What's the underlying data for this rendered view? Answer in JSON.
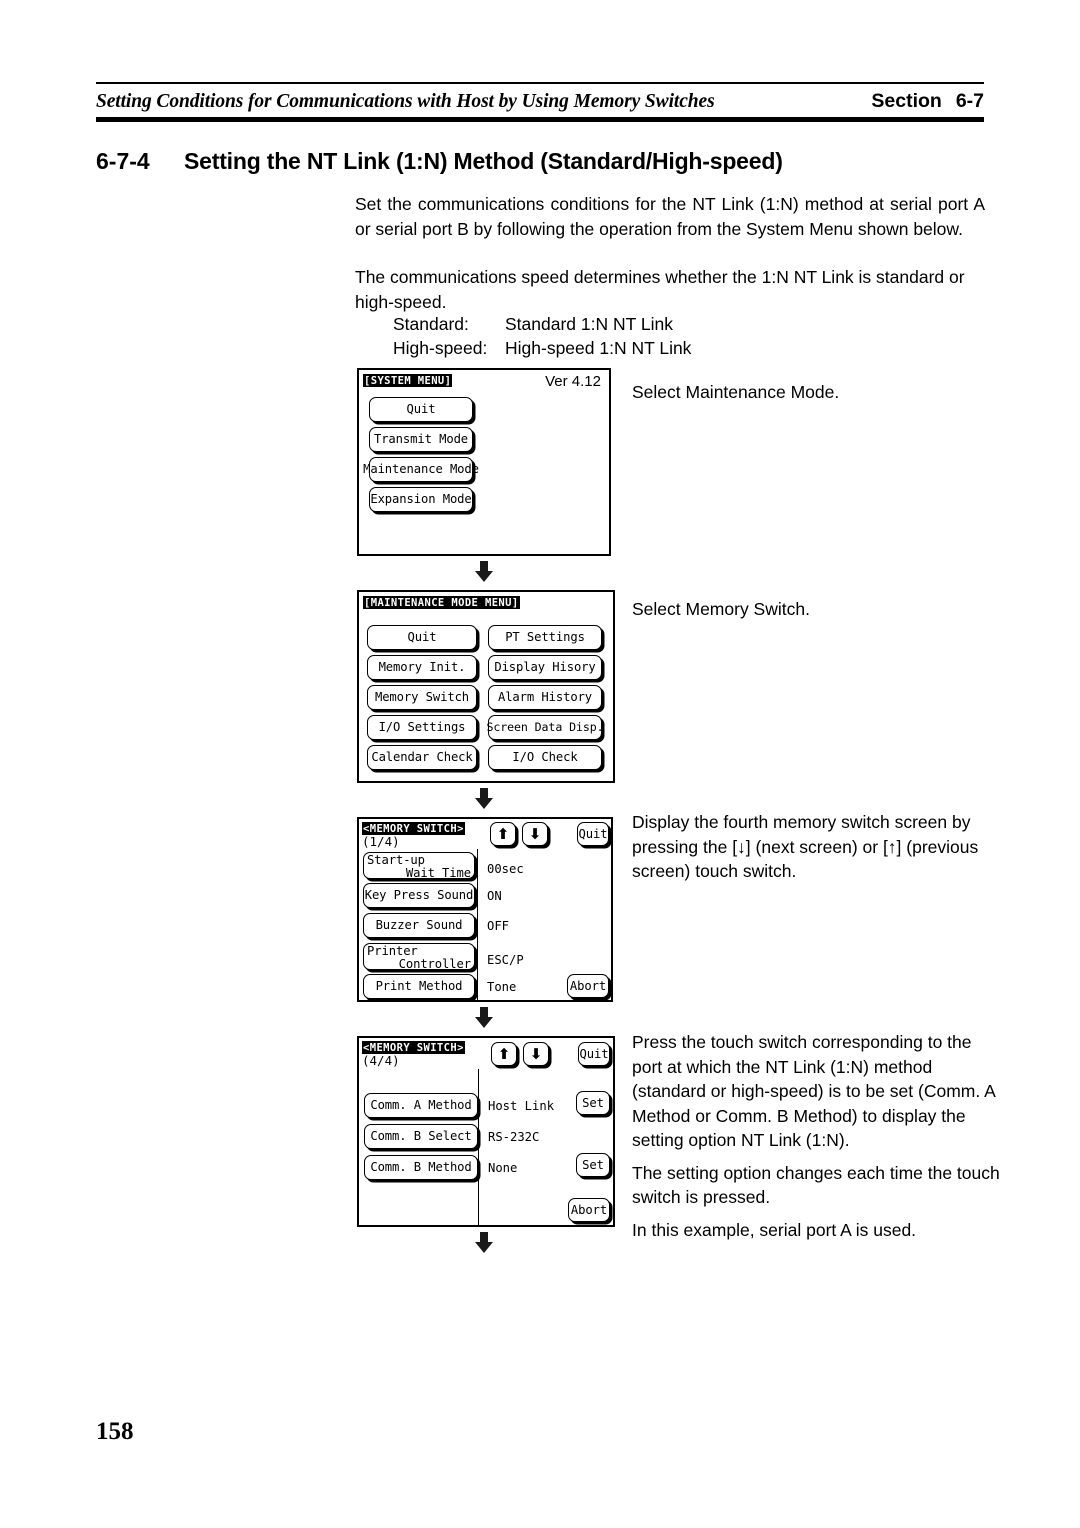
{
  "running_head": {
    "left_text": "Setting Conditions for Communications with Host by Using Memory Switches",
    "right_label": "Section",
    "right_number": "6-7"
  },
  "section": {
    "number": "6-7-4",
    "title": "Setting the NT Link (1:N) Method (Standard/High-speed)"
  },
  "intro": {
    "paragraph_1": "Set the communications conditions for the NT Link (1:N) method at serial port A or serial port B by following the operation from the System Menu shown below.",
    "paragraph_2": "The communications speed determines whether the 1:N NT Link is standard or high-speed.",
    "speed_list": [
      {
        "label": "Standard:",
        "value": "Standard 1:N NT Link"
      },
      {
        "label": "High-speed:",
        "value": "High-speed 1:N NT Link"
      }
    ]
  },
  "screens": {
    "system_menu": {
      "title": "[SYSTEM MENU]",
      "version": "Ver 4.12",
      "buttons": [
        "Quit",
        "Transmit Mode",
        "Maintenance Mode",
        "Expansion Mode"
      ]
    },
    "maintenance_menu": {
      "title": "[MAINTENANCE MODE MENU]",
      "left_buttons": [
        "Quit",
        "Memory Init.",
        "Memory Switch",
        "I/O Settings",
        "Calendar Check"
      ],
      "right_buttons": [
        "PT Settings",
        "Display Hisory",
        "Alarm History",
        "Screen Data Disp.",
        "I/O Check"
      ]
    },
    "memory_switch_1": {
      "title": "<MEMORY SWITCH>",
      "page": "(1/4)",
      "up_arrow": "⬆",
      "down_arrow": "⬇",
      "quit_label": "Quit",
      "abort_label": "Abort",
      "rows": [
        {
          "label_line1": "Start-up",
          "label_line2": "Wait Time",
          "value": "00sec"
        },
        {
          "label_line1": "Key Press Sound",
          "label_line2": "",
          "value": "ON"
        },
        {
          "label_line1": "Buzzer Sound",
          "label_line2": "",
          "value": "OFF"
        },
        {
          "label_line1": "Printer",
          "label_line2": "Controller",
          "value": "ESC/P"
        },
        {
          "label_line1": "Print Method",
          "label_line2": "",
          "value": "Tone"
        }
      ]
    },
    "memory_switch_4": {
      "title": "<MEMORY SWITCH>",
      "page": "(4/4)",
      "up_arrow": "⬆",
      "down_arrow": "⬇",
      "quit_label": "Quit",
      "abort_label": "Abort",
      "set_label_1": "Set",
      "set_label_2": "Set",
      "rows": [
        {
          "label": "Comm. A Method",
          "value": "Host Link"
        },
        {
          "label": "Comm. B Select",
          "value": "RS-232C"
        },
        {
          "label": "Comm. B Method",
          "value": "None"
        }
      ]
    }
  },
  "notes": {
    "note_1": "Select Maintenance Mode.",
    "note_2": "Select Memory Switch.",
    "note_3": "Display the fourth memory switch screen by pressing the [↓] (next screen) or [↑] (previous screen) touch switch.",
    "note_4_p1": "Press the touch switch corresponding to the port at which the NT Link (1:N) method (standard or high-speed) is to be set (Comm. A Method or Comm. B Method) to display the setting option NT Link (1:N).",
    "note_4_p2": "The setting option changes each time the touch switch is pressed.",
    "note_4_p3": "In this example, serial port A is used."
  },
  "footer": {
    "page_number": "158"
  }
}
